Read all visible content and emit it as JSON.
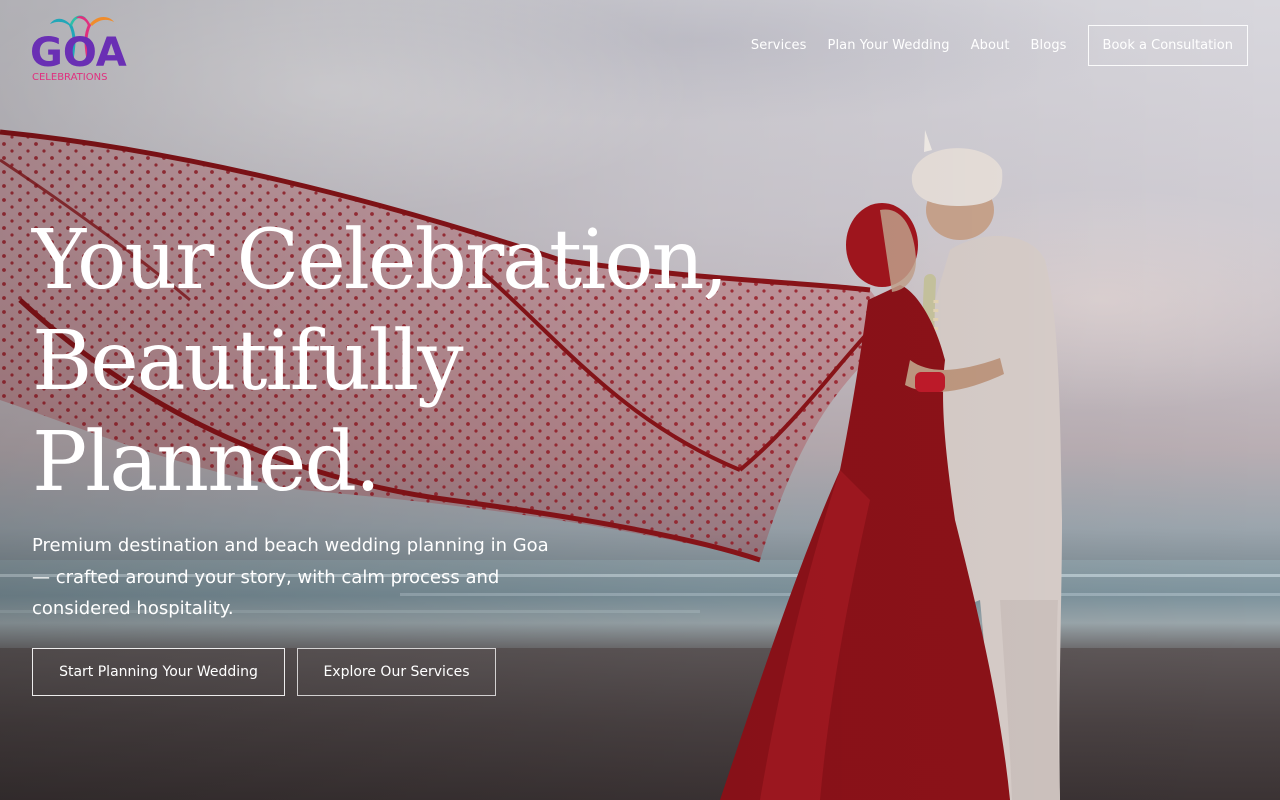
{
  "brand": {
    "logo_word": "GOA",
    "logo_sub": "CELEBRATIONS"
  },
  "nav": {
    "items": [
      {
        "label": "Services"
      },
      {
        "label": "Plan Your Wedding"
      },
      {
        "label": "About"
      },
      {
        "label": "Blogs"
      }
    ],
    "cta_label": "Book a Consultation"
  },
  "hero": {
    "title": "Your Celebration, Beautifully Planned.",
    "subtitle": "Premium destination and beach wedding planning in Goa — crafted around your story, with calm process and considered hospitality.",
    "primary_button": "Start Planning Your Wedding",
    "secondary_button": "Explore Our Services",
    "background_image": "bride-and-groom-beach-photo"
  },
  "colors": {
    "text": "#ffffff",
    "veil_red": "#a81d24",
    "logo_purple": "#6a2fb4",
    "logo_pink": "#e0307f",
    "logo_teal": "#22a7b8"
  }
}
